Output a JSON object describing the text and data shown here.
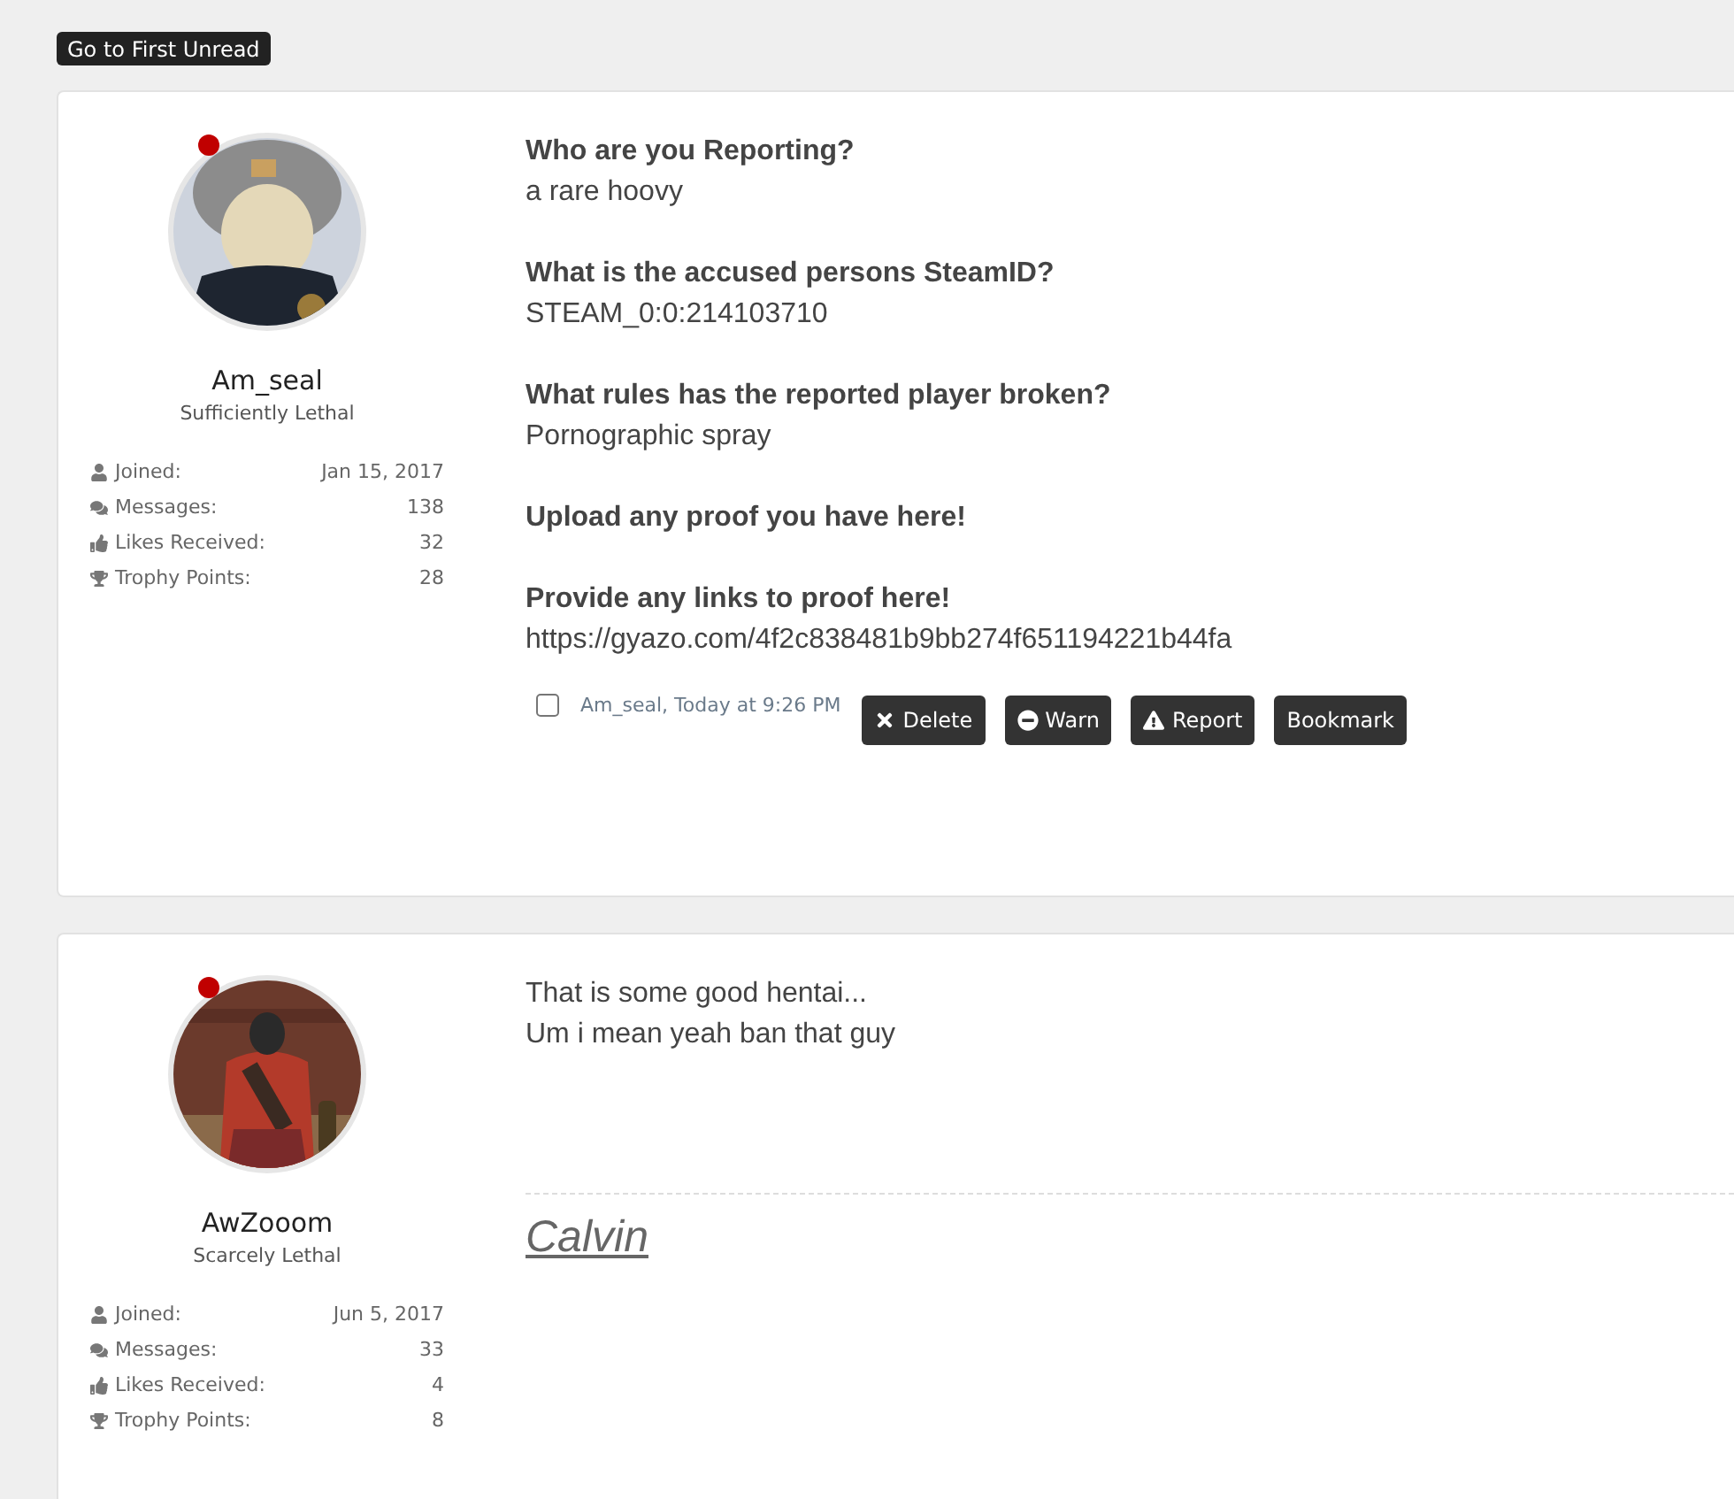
{
  "top_button": "Go to First Unread",
  "posts": [
    {
      "author": {
        "name": "Am_seal",
        "title": "Sufficiently Lethal",
        "online": true
      },
      "stats": [
        {
          "kind": "joined",
          "label": "Joined:",
          "value": "Jan 15, 2017"
        },
        {
          "kind": "messages",
          "label": "Messages:",
          "value": "138"
        },
        {
          "kind": "likes",
          "label": "Likes Received:",
          "value": "32"
        },
        {
          "kind": "trophy",
          "label": "Trophy Points:",
          "value": "28"
        }
      ],
      "sections": [
        {
          "question": "Who are you Reporting?",
          "answer": "a rare hoovy"
        },
        {
          "question": "What is the accused persons SteamID?",
          "answer": "STEAM_0:0:214103710"
        },
        {
          "question": "What rules has the reported player broken?",
          "answer": "Pornographic spray"
        },
        {
          "question": "Upload any proof you have here!"
        },
        {
          "question": "Provide any links to proof here!",
          "answer": "https://gyazo.com/4f2c838481b9bb274f651194221b44fa"
        }
      ],
      "footer": {
        "checked": false,
        "byline": "Am_seal, Today at 9:26 PM",
        "actions": [
          {
            "kind": "delete",
            "label": "Delete"
          },
          {
            "kind": "warn",
            "label": "Warn"
          },
          {
            "kind": "report",
            "label": "Report"
          },
          {
            "kind": "bookmark",
            "label": "Bookmark"
          }
        ]
      }
    },
    {
      "author": {
        "name": "AwZooom",
        "title": "Scarcely Lethal",
        "online": true
      },
      "stats": [
        {
          "kind": "joined",
          "label": "Joined:",
          "value": "Jun 5, 2017"
        },
        {
          "kind": "messages",
          "label": "Messages:",
          "value": "33"
        },
        {
          "kind": "likes",
          "label": "Likes Received:",
          "value": "4"
        },
        {
          "kind": "trophy",
          "label": "Trophy Points:",
          "value": "8"
        }
      ],
      "lines": [
        "That is some good hentai...",
        "Um i mean yeah ban that guy"
      ],
      "signature": "Calvin"
    }
  ]
}
